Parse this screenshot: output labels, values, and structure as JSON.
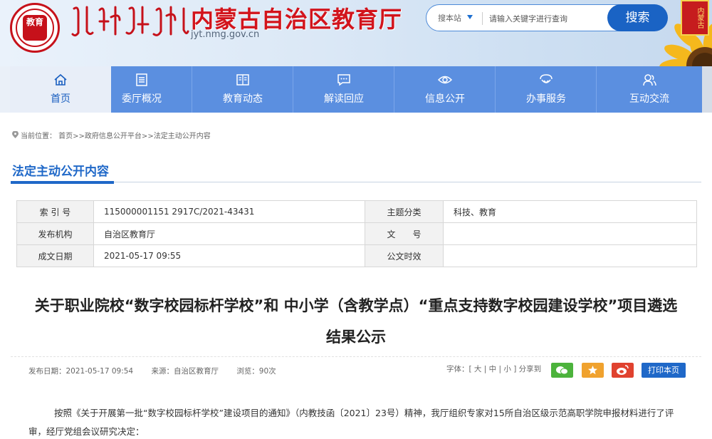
{
  "header": {
    "emblem_text": "教育",
    "title": "内蒙古自治区教育厅",
    "domain": "jyt.nmg.gov.cn",
    "search": {
      "scope": "搜本站",
      "placeholder": "请输入关键字进行查询",
      "button": "搜索"
    },
    "badge_text": "内蒙古"
  },
  "nav": {
    "items": [
      {
        "label": "首页",
        "icon": "home-icon"
      },
      {
        "label": "委厅概况",
        "icon": "list-icon"
      },
      {
        "label": "教育动态",
        "icon": "book-icon"
      },
      {
        "label": "解读回应",
        "icon": "chat-icon"
      },
      {
        "label": "信息公开",
        "icon": "eye-icon"
      },
      {
        "label": "办事服务",
        "icon": "service-icon"
      },
      {
        "label": "互动交流",
        "icon": "people-icon"
      }
    ]
  },
  "breadcrumb": "当前位置： 首页>>政府信息公开平台>>法定主动公开内容",
  "section_title": "法定主动公开内容",
  "info": {
    "index_label": "索 引 号",
    "index_value": "115000001151 2917C/2021-43431",
    "topic_label": "主题分类",
    "topic_value": "科技、教育",
    "org_label": "发布机构",
    "org_value": "自治区教育厅",
    "docno_label": "文　　号",
    "docno_value": "",
    "date_label": "成文日期",
    "date_value": "2021-05-17 09:55",
    "validity_label": "公文时效",
    "validity_value": ""
  },
  "article": {
    "title": "关于职业院校“数字校园标杆学校”和 中小学（含教学点）“重点支持数字校园建设学校”项目遴选结果公示",
    "publish_date": "发布日期：2021-05-17 09:54",
    "source": "来源：自治区教育厅",
    "views": "浏览：90次",
    "font_size_tools": "字体：[ 大 | 中 | 小 ] 分享到",
    "print": "打印本页",
    "body": "按照《关于开展第一批“数字校园标杆学校”建设项目的通知》（内教技函〔2021〕23号）精神，我厅组织专家对15所自治区级示范高职学院申报材料进行了评审，经厅党组会议研究决定："
  },
  "colors": {
    "brand_red": "#d2141c",
    "nav_blue": "#5b8fe0",
    "accent_blue": "#1f68c8"
  }
}
